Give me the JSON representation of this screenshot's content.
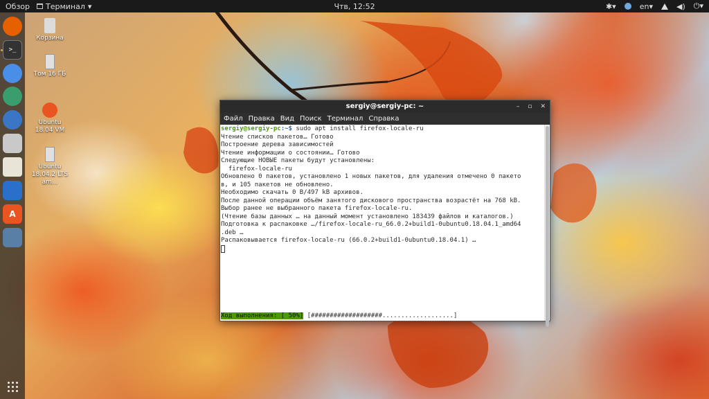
{
  "topbar": {
    "activities": "Обзор",
    "app_name": "Терминал",
    "clock": "Чтв, 12:52",
    "lang": "en"
  },
  "dock": {
    "items": [
      {
        "name": "firefox-icon",
        "color": "#e66000"
      },
      {
        "name": "terminal-icon",
        "color": "#333333"
      },
      {
        "name": "chromium-icon",
        "color": "#4a8fe7"
      },
      {
        "name": "globe-icon",
        "color": "#3a9d6d"
      },
      {
        "name": "thunderbird-icon",
        "color": "#3b76c4"
      },
      {
        "name": "files-icon",
        "color": "#c9c9c9"
      },
      {
        "name": "rhythmbox-icon",
        "color": "#e8e4d8"
      },
      {
        "name": "writer-icon",
        "color": "#2a6fc9"
      },
      {
        "name": "software-center-icon",
        "color": "#e95420"
      },
      {
        "name": "virtualbox-icon",
        "color": "#5a7fa6"
      }
    ]
  },
  "desktop": {
    "icons": [
      {
        "label": "Корзина"
      },
      {
        "label": "Том 16 ГБ"
      },
      {
        "label": "Ubuntu 18.04 VM"
      },
      {
        "label": "Ubuntu 18.04.2 LTS am..."
      }
    ]
  },
  "terminal": {
    "title": "sergiy@sergiy-pc: ~",
    "menu": [
      "Файл",
      "Правка",
      "Вид",
      "Поиск",
      "Терминал",
      "Справка"
    ],
    "prompt_user": "sergiy@sergiy-pc",
    "prompt_path": ":~$",
    "command": " sudo apt install firefox-locale-ru",
    "lines": [
      "Чтение списков пакетов… Готово",
      "Построение дерева зависимостей",
      "Чтение информации о состоянии… Готово",
      "Следующие НОВЫЕ пакеты будут установлены:",
      "  firefox-locale-ru",
      "Обновлено 0 пакетов, установлено 1 новых пакетов, для удаления отмечено 0 пакето",
      "в, и 105 пакетов не обновлено.",
      "Необходимо скачать 0 B/497 kB архивов.",
      "После данной операции объём занятого дискового пространства возрастёт на 768 kB.",
      "Выбор ранее не выбранного пакета firefox-locale-ru.",
      "(Чтение базы данных … на данный момент установлено 183439 файлов и каталогов.)",
      "Подготовка к распаковке …/firefox-locale-ru_66.0.2+build1-0ubuntu0.18.04.1_amd64",
      ".deb …",
      "Распаковывается firefox-locale-ru (66.0.2+build1-0ubuntu0.18.04.1) …"
    ],
    "progress_label": "Ход выполнения: [ 50%]",
    "progress_bar": " [###################...................]",
    "progress_value": 0.5
  }
}
